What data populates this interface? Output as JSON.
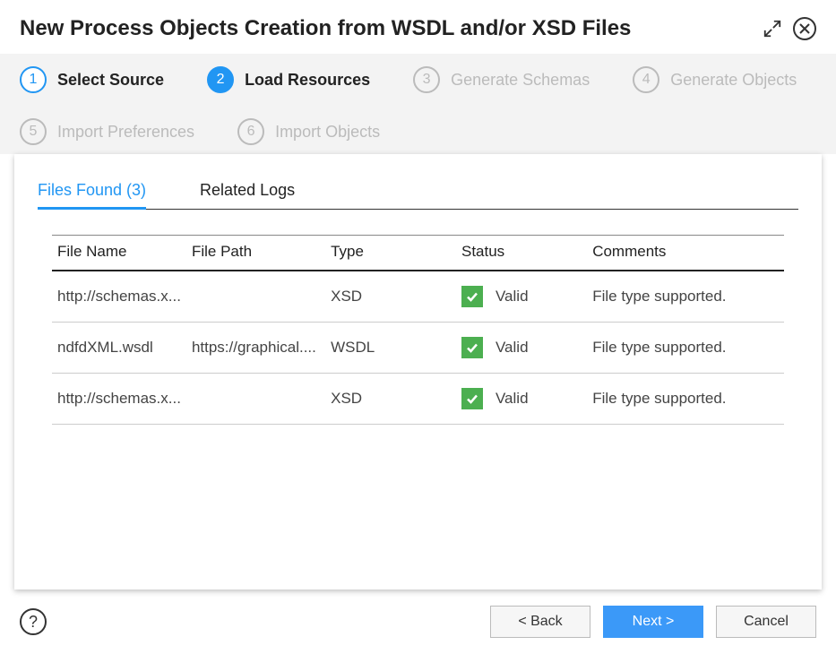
{
  "title": "New Process Objects Creation from WSDL and/or XSD Files",
  "steps": [
    {
      "num": "1",
      "label": "Select Source",
      "state": "completed"
    },
    {
      "num": "2",
      "label": "Load Resources",
      "state": "active"
    },
    {
      "num": "3",
      "label": "Generate Schemas",
      "state": "upcoming"
    },
    {
      "num": "4",
      "label": "Generate Objects",
      "state": "upcoming"
    },
    {
      "num": "5",
      "label": "Import Preferences",
      "state": "upcoming"
    },
    {
      "num": "6",
      "label": "Import Objects",
      "state": "upcoming"
    }
  ],
  "tabs": {
    "files": "Files Found (3)",
    "logs": "Related Logs"
  },
  "table": {
    "headers": {
      "name": "File Name",
      "path": "File Path",
      "type": "Type",
      "status": "Status",
      "comments": "Comments"
    },
    "rows": [
      {
        "name": "http://schemas.x...",
        "path": "",
        "type": "XSD",
        "status": "Valid",
        "comments": "File type supported."
      },
      {
        "name": "ndfdXML.wsdl",
        "path": "https://graphical....",
        "type": "WSDL",
        "status": "Valid",
        "comments": "File type supported."
      },
      {
        "name": "http://schemas.x...",
        "path": "",
        "type": "XSD",
        "status": "Valid",
        "comments": "File type supported."
      }
    ]
  },
  "buttons": {
    "back": "< Back",
    "next": "Next >",
    "cancel": "Cancel"
  },
  "help": "?"
}
